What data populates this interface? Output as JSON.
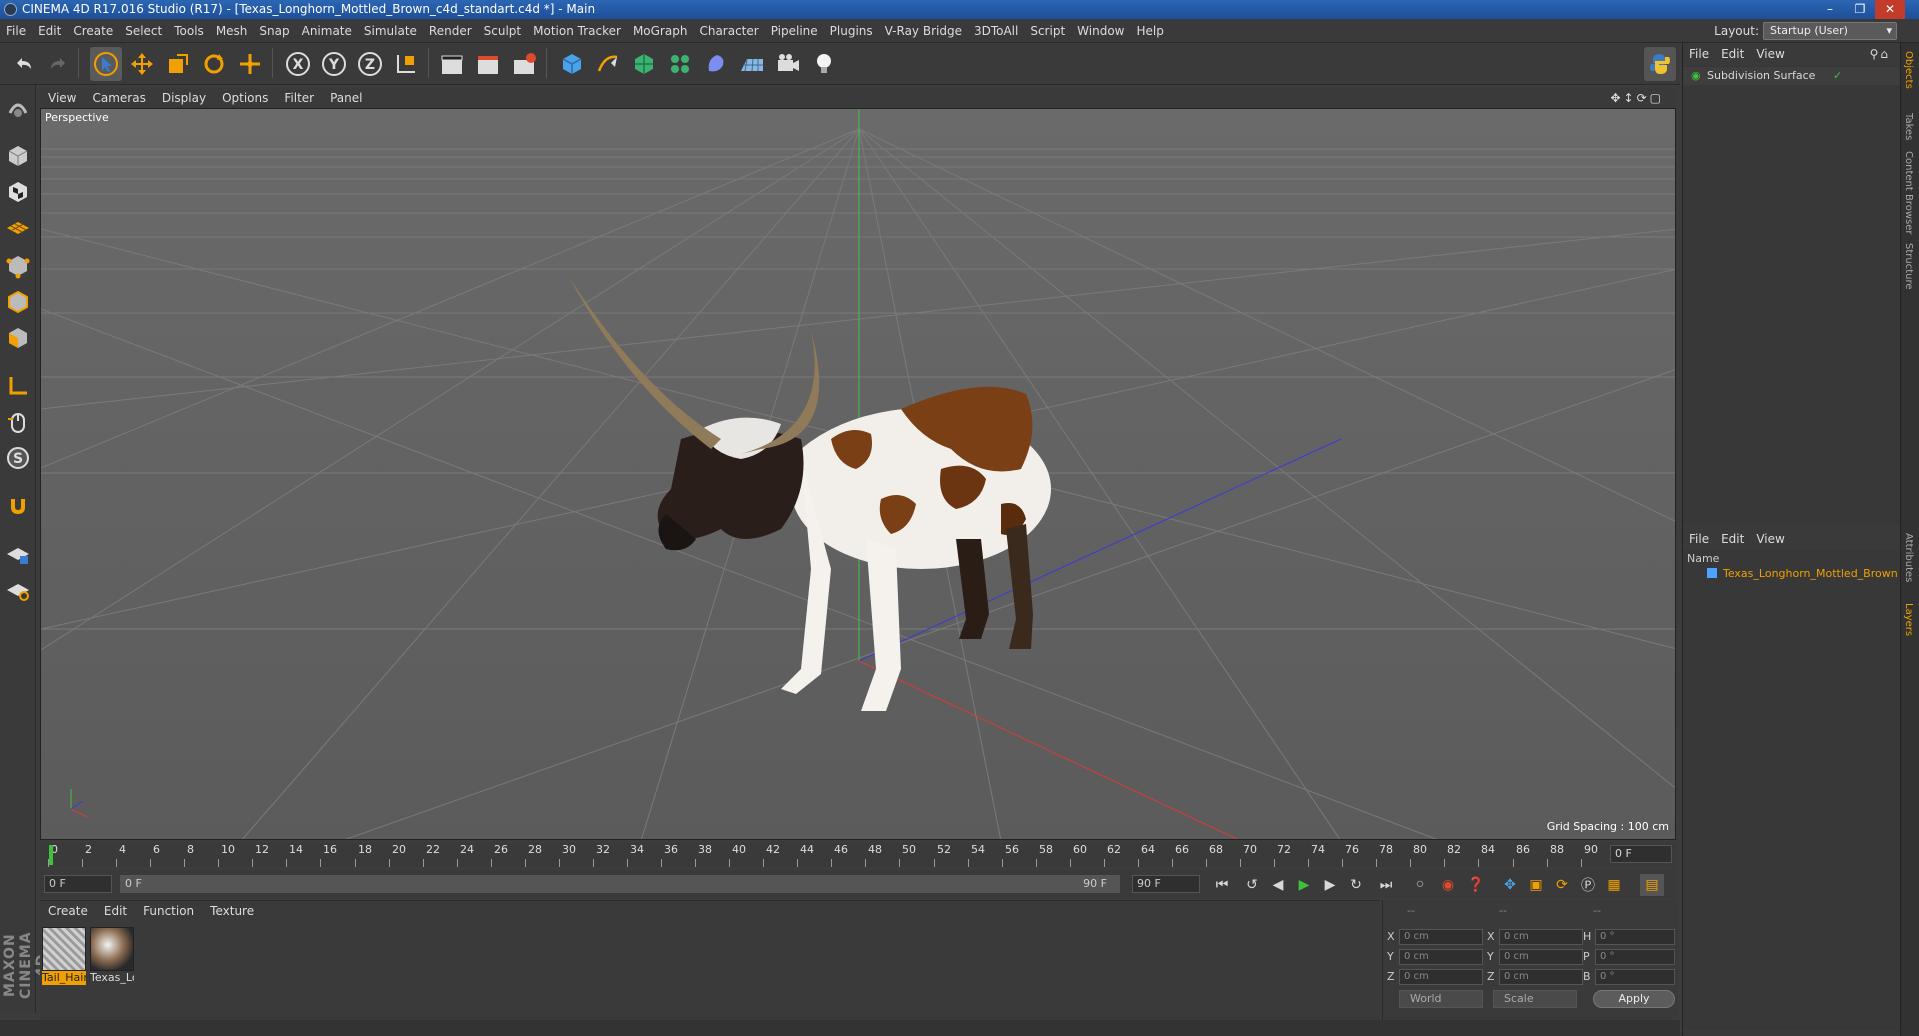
{
  "window": {
    "title": "CINEMA 4D R17.016 Studio (R17) - [Texas_Longhorn_Mottled_Brown_c4d_standart.c4d *] - Main",
    "controls": [
      "minimize",
      "restore",
      "close"
    ]
  },
  "menubar": {
    "items": [
      "File",
      "Edit",
      "Create",
      "Select",
      "Tools",
      "Mesh",
      "Snap",
      "Animate",
      "Simulate",
      "Render",
      "Sculpt",
      "Motion Tracker",
      "MoGraph",
      "Character",
      "Pipeline",
      "Plugins",
      "V-Ray Bridge",
      "3DToAll",
      "Script",
      "Window",
      "Help"
    ],
    "layout_label": "Layout:",
    "layout_value": "Startup (User)"
  },
  "viewport": {
    "menu": [
      "View",
      "Cameras",
      "Display",
      "Options",
      "Filter",
      "Panel"
    ],
    "label": "Perspective",
    "grid_spacing": "Grid Spacing : 100 cm"
  },
  "timeline": {
    "ticks": [
      "0",
      "2",
      "4",
      "6",
      "8",
      "10",
      "12",
      "14",
      "16",
      "18",
      "20",
      "22",
      "24",
      "26",
      "28",
      "30",
      "32",
      "34",
      "36",
      "38",
      "40",
      "42",
      "44",
      "46",
      "48",
      "50",
      "52",
      "54",
      "56",
      "58",
      "60",
      "62",
      "64",
      "66",
      "68",
      "70",
      "72",
      "74",
      "76",
      "78",
      "80",
      "82",
      "84",
      "86",
      "88",
      "90"
    ],
    "current_frame": "0 F"
  },
  "playback": {
    "start": "0 F",
    "range_start": "0 F",
    "range_end": "90 F",
    "end": "90 F"
  },
  "materials": {
    "menu": [
      "Create",
      "Edit",
      "Function",
      "Texture"
    ],
    "items": [
      {
        "name": "Tail_Hair",
        "selected": true
      },
      {
        "name": "Texas_Lo",
        "selected": false
      }
    ]
  },
  "coordinates": {
    "header": [
      "--",
      "--",
      "--"
    ],
    "rows": [
      {
        "axis": "X",
        "pos": "0 cm",
        "axis2": "X",
        "size": "0 cm",
        "rot_label": "H",
        "rot": "0 °"
      },
      {
        "axis": "Y",
        "pos": "0 cm",
        "axis2": "Y",
        "size": "0 cm",
        "rot_label": "P",
        "rot": "0 °"
      },
      {
        "axis": "Z",
        "pos": "0 cm",
        "axis2": "Z",
        "size": "0 cm",
        "rot_label": "B",
        "rot": "0 °"
      }
    ],
    "mode": "World",
    "transform": "Scale",
    "apply": "Apply"
  },
  "objects_panel": {
    "menu": [
      "File",
      "Edit",
      "View"
    ],
    "objects": [
      {
        "name": "Subdivision Surface"
      }
    ]
  },
  "layers_panel": {
    "menu": [
      "File",
      "Edit",
      "View"
    ],
    "column_header": "Name",
    "layers": [
      {
        "name": "Texas_Longhorn_Mottled_Brown",
        "color": "#4da3ff"
      }
    ]
  },
  "side_tabs": [
    "Objects",
    "Takes",
    "Content Browser",
    "Structure",
    "Attributes",
    "Layers"
  ],
  "branding": {
    "logo": "MAXON CINEMA 4D"
  },
  "colors": {
    "accent": "#f0a000",
    "selected_text": "#f0a000",
    "titlebar": "#2c66b3"
  }
}
